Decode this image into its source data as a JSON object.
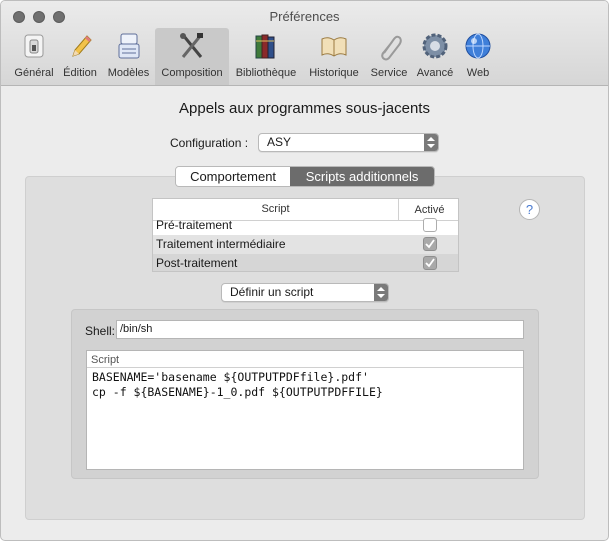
{
  "window": {
    "title": "Préférences"
  },
  "toolbar": {
    "items": [
      {
        "label": "Général",
        "icon": "switch-icon"
      },
      {
        "label": "Édition",
        "icon": "pencil-icon"
      },
      {
        "label": "Modèles",
        "icon": "templates-icon"
      },
      {
        "label": "Composition",
        "icon": "tools-icon",
        "selected": true
      },
      {
        "label": "Bibliothèque",
        "icon": "books-icon"
      },
      {
        "label": "Historique",
        "icon": "open-book-icon"
      },
      {
        "label": "Service",
        "icon": "paperclip-icon"
      },
      {
        "label": "Avancé",
        "icon": "gear-icon"
      },
      {
        "label": "Web",
        "icon": "globe-icon"
      }
    ]
  },
  "main": {
    "heading": "Appels aux programmes sous-jacents",
    "config_label": "Configuration :",
    "config_value": "ASY",
    "tabs": [
      "Comportement",
      "Scripts additionnels"
    ],
    "selected_tab": "Scripts additionnels",
    "help_label": "?",
    "table": {
      "headers": [
        "Script",
        "Activé"
      ],
      "rows": [
        {
          "name": "Pré-traitement",
          "active": false
        },
        {
          "name": "Traitement intermédiaire",
          "active": true
        },
        {
          "name": "Post-traitement",
          "active": true
        }
      ]
    },
    "define_popup": "Définir un script",
    "shell_label": "Shell:",
    "shell_value": "/bin/sh",
    "script_label": "Script",
    "script_text": "BASENAME='basename ${OUTPUTPDFfile}.pdf'\ncp -f ${BASENAME}-1_0.pdf ${OUTPUTPDFFILE}"
  },
  "colors": {
    "selected_tab_bg": "#6c6c6c",
    "window_bg": "#ececec",
    "accent": "#4a7bd0"
  }
}
